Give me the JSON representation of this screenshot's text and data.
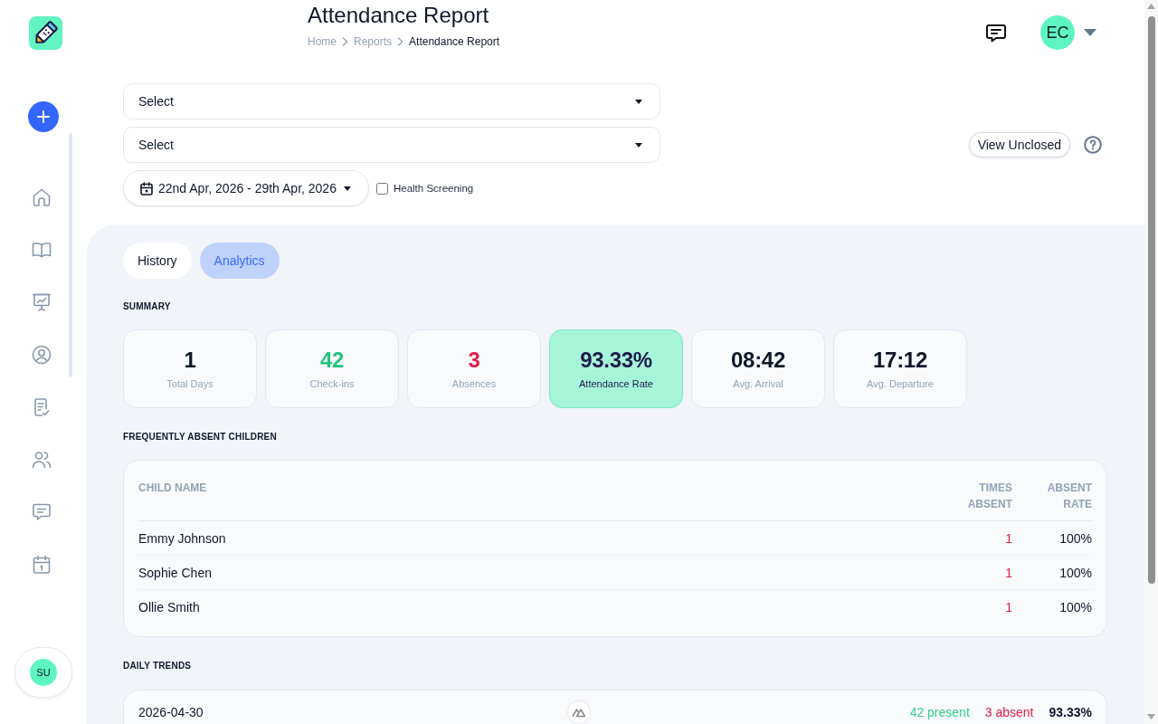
{
  "sidebar": {
    "user_initials": "SU"
  },
  "header": {
    "title": "Attendance Report",
    "breadcrumb": [
      {
        "label": "Home",
        "current": false
      },
      {
        "label": "Reports",
        "current": false
      },
      {
        "label": "Attendance Report",
        "current": true
      }
    ],
    "user_initials": "EC"
  },
  "filters": {
    "selects": [
      {
        "value": "Select"
      },
      {
        "value": "Select"
      }
    ],
    "date_range": "22nd Apr, 2026 - 29th Apr, 2026",
    "health_screening": {
      "label": "Health Screening",
      "checked": false
    },
    "view_unclosed": "View Unclosed"
  },
  "tabs": [
    {
      "label": "History",
      "selected": false
    },
    {
      "label": "Analytics",
      "selected": true
    }
  ],
  "summary": {
    "title": "SUMMARY",
    "cards": [
      {
        "value": "1",
        "label": "Total Days",
        "kind": "neutral"
      },
      {
        "value": "42",
        "label": "Check-ins",
        "kind": "positive"
      },
      {
        "value": "3",
        "label": "Absences",
        "kind": "negative"
      },
      {
        "value": "93.33%",
        "label": "Attendance Rate",
        "kind": "highlight"
      },
      {
        "value": "08:42",
        "label": "Avg. Arrival",
        "kind": "neutral"
      },
      {
        "value": "17:12",
        "label": "Avg. Departure",
        "kind": "neutral"
      }
    ]
  },
  "absent_children": {
    "title": "FREQUENTLY ABSENT CHILDREN",
    "columns": [
      "CHILD NAME",
      "TIMES ABSENT",
      "ABSENT RATE"
    ],
    "rows": [
      {
        "name": "Emmy Johnson",
        "times_absent": "1",
        "absent_rate": "100%"
      },
      {
        "name": "Sophie Chen",
        "times_absent": "1",
        "absent_rate": "100%"
      },
      {
        "name": "Ollie Smith",
        "times_absent": "1",
        "absent_rate": "100%"
      }
    ]
  },
  "daily_trends": {
    "title": "DAILY TRENDS",
    "rows": [
      {
        "date": "2026-04-30",
        "present": "42 present",
        "absent": "3 absent",
        "rate": "93.33%"
      }
    ]
  }
}
